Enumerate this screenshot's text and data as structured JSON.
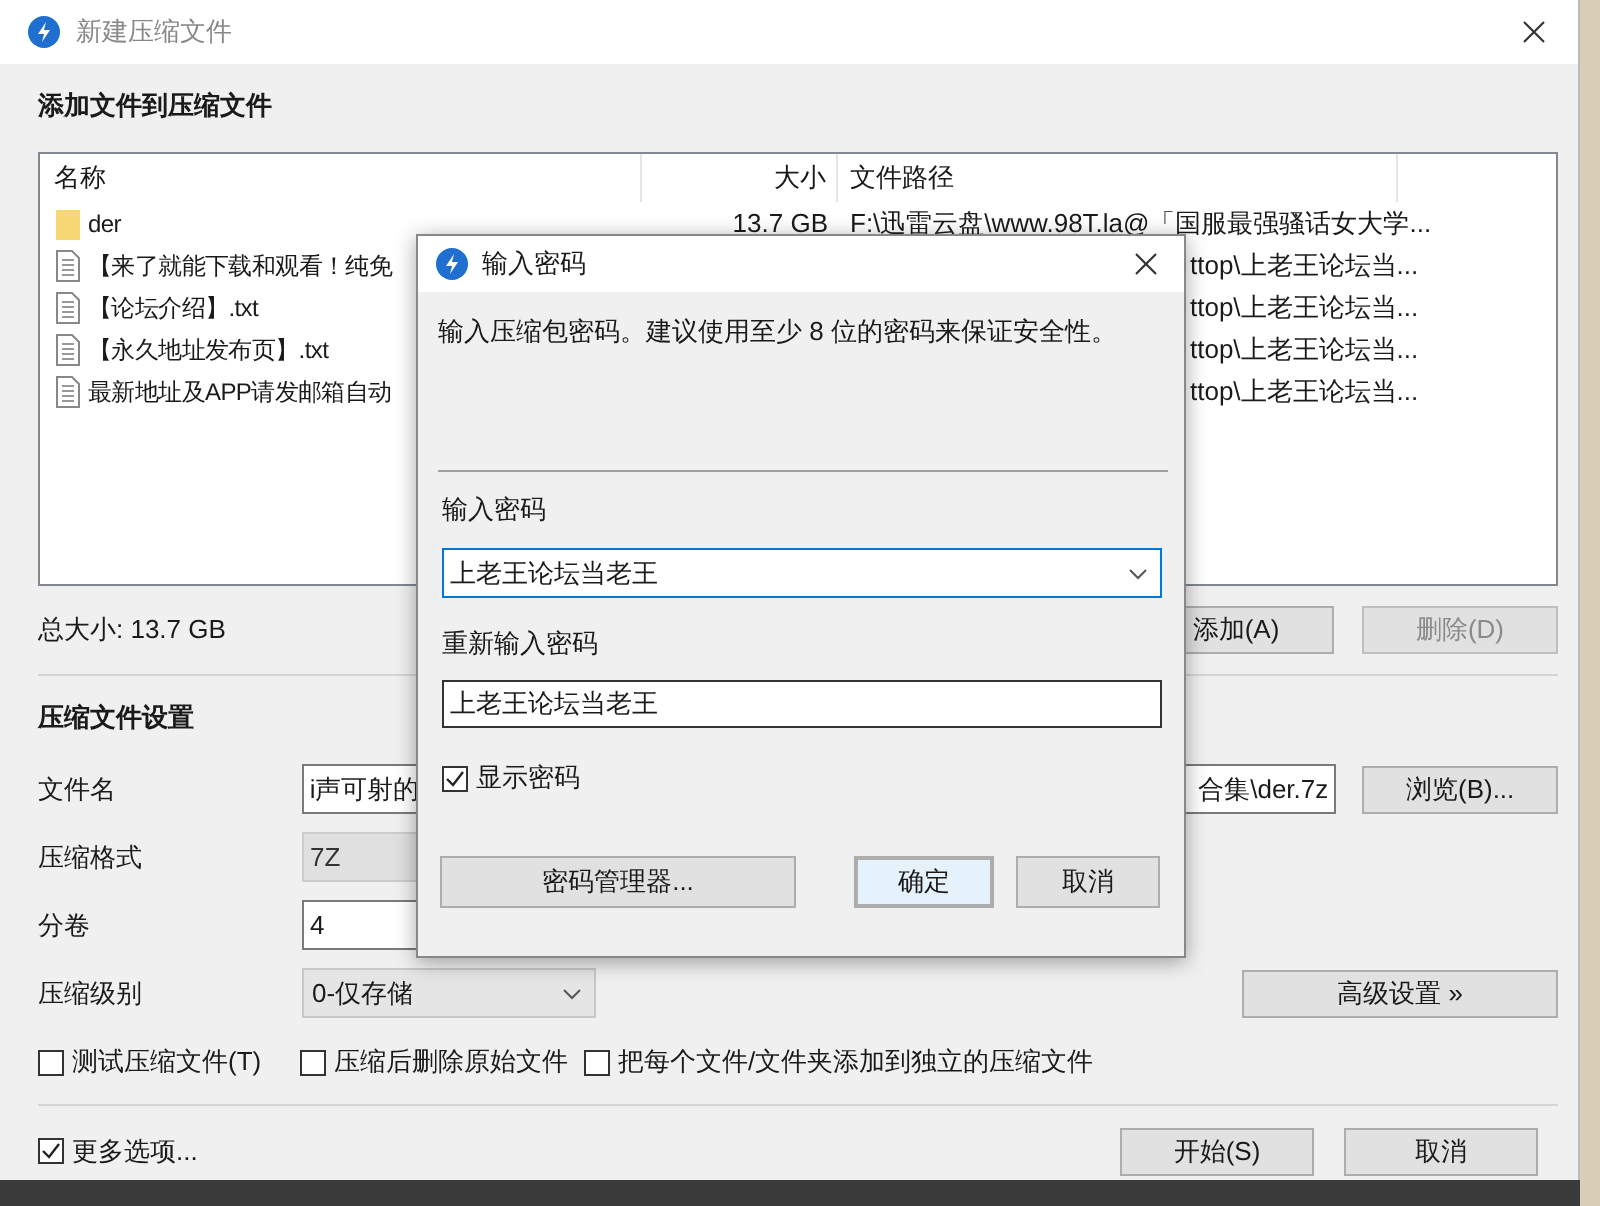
{
  "window": {
    "title": "新建压缩文件"
  },
  "files": {
    "heading": "添加文件到压缩文件",
    "columns": [
      "名称",
      "大小",
      "文件路径"
    ],
    "rows": [
      {
        "kind": "folder",
        "name": "der",
        "size": "13.7 GB",
        "path": "F:\\迅雷云盘\\www.98T.la@「国服最强骚话女大学..."
      },
      {
        "kind": "file",
        "name": "【来了就能下载和观看！纯免",
        "path": "ttop\\上老王论坛当..."
      },
      {
        "kind": "file",
        "name": "【论坛介绍】.txt",
        "path": "ttop\\上老王论坛当..."
      },
      {
        "kind": "file",
        "name": "【永久地址发布页】.txt",
        "path": "ttop\\上老王论坛当..."
      },
      {
        "kind": "file",
        "name": "最新地址及APP请发邮箱自动",
        "path": "ttop\\上老王论坛当..."
      }
    ],
    "total": "总大小: 13.7 GB",
    "buttons": [
      {
        "label": "添加(A)",
        "disabled": false
      },
      {
        "label": "删除(D)",
        "disabled": true
      }
    ]
  },
  "settings": {
    "heading": "压缩文件设置",
    "filename": {
      "label": "文件名",
      "value_left": "i声可射的",
      "value_right": "合集\\der.7z"
    },
    "browse_button": "浏览(B)...",
    "format": {
      "label": "压缩格式",
      "value": "7Z",
      "disabled": true
    },
    "split": {
      "label": "分卷",
      "value": "4"
    },
    "level": {
      "label": "压缩级别",
      "value": "0-仅存储"
    },
    "advanced_button": "高级设置 »",
    "options": [
      {
        "label": "测试压缩文件(T)",
        "checked": false
      },
      {
        "label": "压缩后删除原始文件",
        "checked": false
      },
      {
        "label": "把每个文件/文件夹添加到独立的压缩文件",
        "checked": false
      }
    ]
  },
  "more_options": {
    "label": "更多选项...",
    "checked": true
  },
  "footer_buttons": [
    "开始(S)",
    "取消"
  ],
  "password_dialog": {
    "title": "输入密码",
    "message": "输入压缩包密码。建议使用至少 8 位的密码来保证安全性。",
    "password": {
      "label": "输入密码",
      "value": "上老王论坛当老王"
    },
    "confirm": {
      "label": "重新输入密码",
      "value": "上老王论坛当老王"
    },
    "show_password": {
      "label": "显示密码",
      "checked": true
    },
    "buttons": [
      {
        "label": "密码管理器...",
        "default": false
      },
      {
        "label": "确定",
        "default": true
      },
      {
        "label": "取消",
        "default": false
      }
    ]
  }
}
